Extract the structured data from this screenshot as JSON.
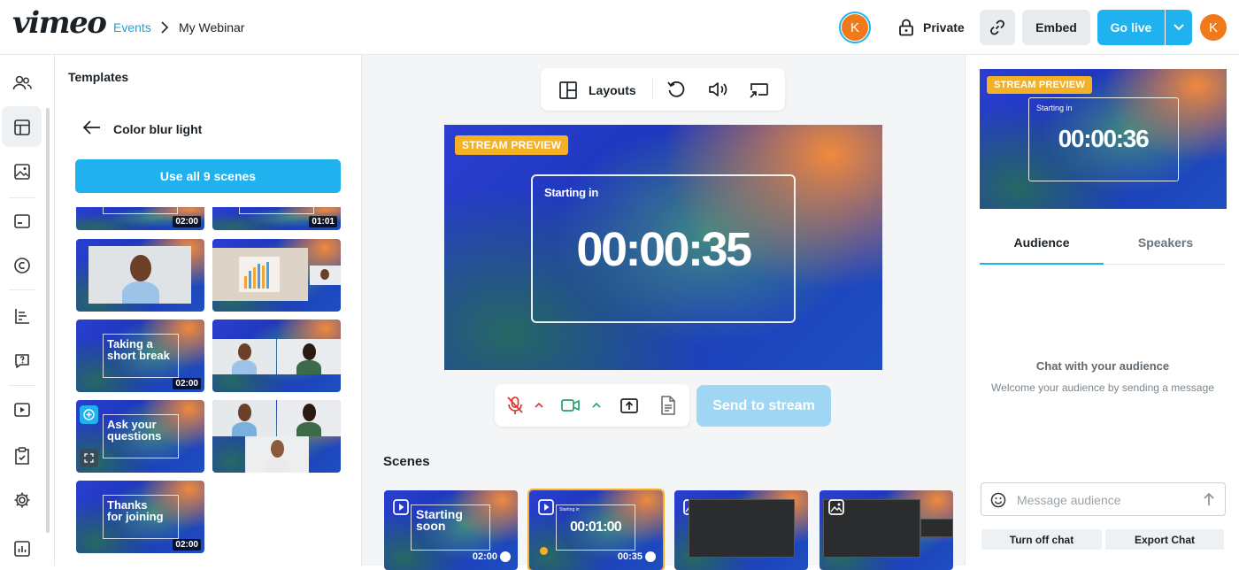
{
  "header": {
    "logo": "vimeo",
    "breadcrumb": {
      "events": "Events",
      "current": "My Webinar"
    },
    "avatar_initial": "K",
    "private_label": "Private",
    "embed_label": "Embed",
    "golive_label": "Go live"
  },
  "nav": {
    "icons": [
      "people-icon",
      "layout-icon",
      "image-icon",
      "caption-icon",
      "copyright-icon",
      "chart-list-icon",
      "question-icon",
      "video-icon",
      "clipboard-icon",
      "gear-icon",
      "analytics-icon"
    ]
  },
  "templates": {
    "title": "Templates",
    "back_title": "Color blur light",
    "use_all_label": "Use all 9 scenes",
    "tiles": [
      {
        "duration": "02:00"
      },
      {
        "duration": "01:01"
      },
      {
        "text": ""
      },
      {
        "text": ""
      },
      {
        "text": "Taking a short break",
        "line1": "Taking a",
        "line2": "short break",
        "duration": "02:00"
      },
      {
        "text": ""
      },
      {
        "line1": "Ask your",
        "line2": "questions"
      },
      {
        "text": ""
      },
      {
        "line1": "Thanks",
        "line2": "for joining",
        "duration": "02:00"
      }
    ]
  },
  "toolbar": {
    "layouts_label": "Layouts"
  },
  "preview": {
    "badge": "STREAM PREVIEW",
    "starting_in": "Starting in",
    "timer": "00:00:35"
  },
  "controls": {
    "send_label": "Send to stream"
  },
  "scenes": {
    "title": "Scenes",
    "items": [
      {
        "line1": "Starting",
        "line2": "soon",
        "duration": "02:00"
      },
      {
        "small": "Starting in",
        "timer": "00:01:00",
        "duration": "00:35"
      },
      {},
      {}
    ]
  },
  "right": {
    "badge": "STREAM PREVIEW",
    "starting_in": "Starting in",
    "timer": "00:00:36",
    "tabs": [
      "Audience",
      "Speakers"
    ],
    "chat_title": "Chat with your audience",
    "chat_sub": "Welcome your audience by sending a message",
    "message_placeholder": "Message audience",
    "turn_off_label": "Turn off chat",
    "export_label": "Export Chat"
  },
  "colors": {
    "accent": "#1fb2ee",
    "orange": "#f07a1a",
    "badge": "#f5b125",
    "send_disabled": "#9fd6f3"
  }
}
